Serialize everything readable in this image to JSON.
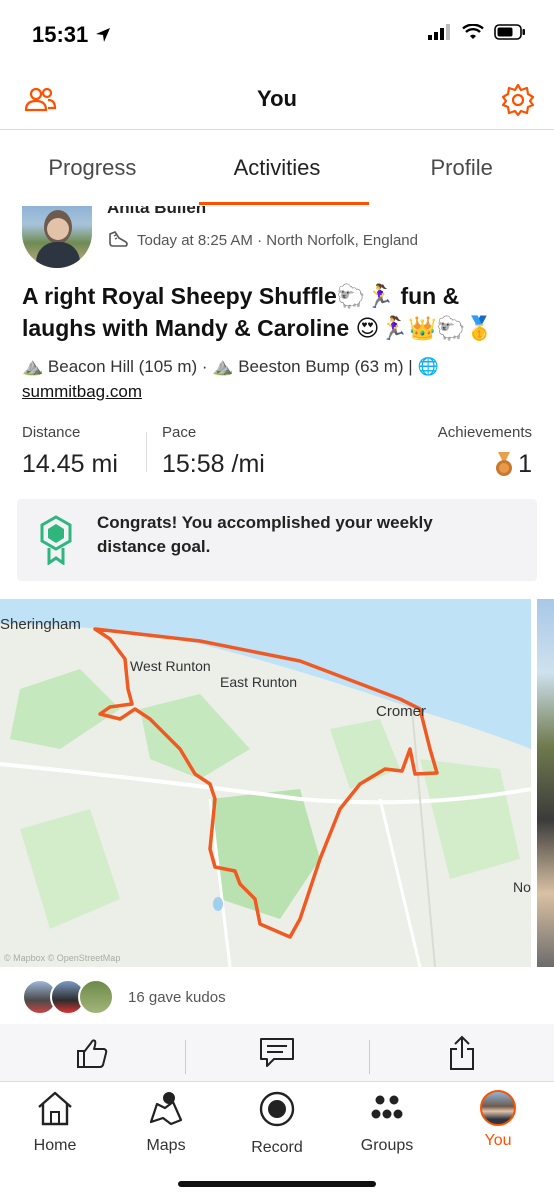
{
  "status": {
    "time": "15:31"
  },
  "header": {
    "title": "You"
  },
  "tabs": [
    {
      "label": "Progress"
    },
    {
      "label": "Activities"
    },
    {
      "label": "Profile"
    }
  ],
  "activity": {
    "athlete": "Anita Bullen",
    "when": "Today at 8:25 AM · North Norfolk, England",
    "title": "A right Royal Sheepy Shuffle🐑🏃‍♀️ fun & laughs with Mandy & Caroline 😍🏃‍♀️👑🐑🥇",
    "summit_1": "Beacon Hill (105 m) ·",
    "summit_2": "Beeston Bump (63 m) |",
    "summit_link": "summitbag.com",
    "stats": {
      "distance_label": "Distance",
      "distance_value": "14.45 mi",
      "pace_label": "Pace",
      "pace_value": "15:58 /mi",
      "achievements_label": "Achievements",
      "achievements_value": "1"
    },
    "congrats": "Congrats! You accomplished your weekly distance goal.",
    "map": {
      "labels": {
        "sheringham": "Sheringham",
        "west_runton": "West Runton",
        "east_runton": "East Runton",
        "cromer": "Cromer",
        "no": "No"
      },
      "attribution": "© Mapbox © OpenStreetMap"
    },
    "kudos": "16 gave kudos"
  },
  "nav": [
    {
      "label": "Home"
    },
    {
      "label": "Maps"
    },
    {
      "label": "Record"
    },
    {
      "label": "Groups"
    },
    {
      "label": "You"
    }
  ],
  "colors": {
    "accent": "#fc5200",
    "route": "#f05a22",
    "goal": "#2fb67f"
  }
}
